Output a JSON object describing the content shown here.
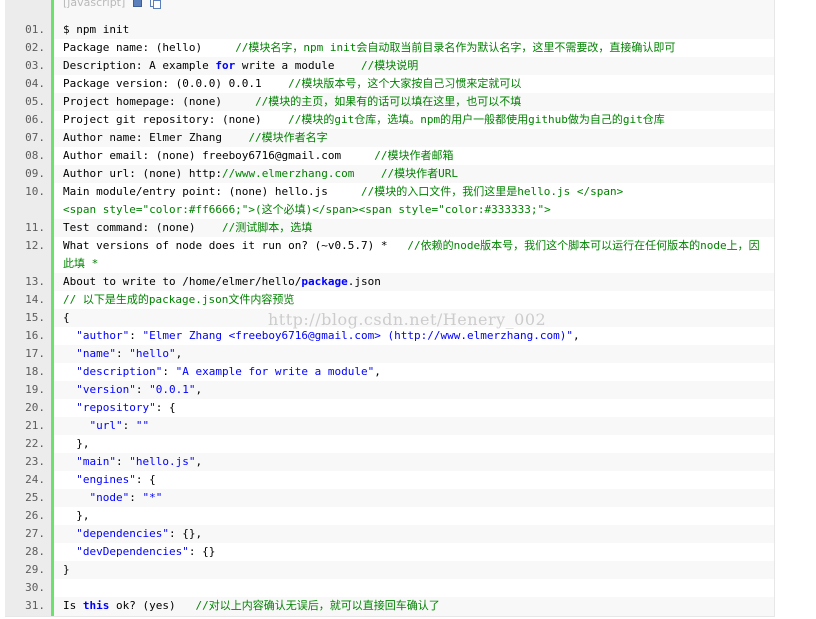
{
  "toolbar": {
    "language_label": "[javascript]",
    "view_icon": "view-source-icon",
    "copy_icon": "copy-icon"
  },
  "watermark": "http://blog.csdn.net/Henery_002",
  "colors": {
    "comment": "#008200",
    "keyword": "#0000ff",
    "gutter_bar": "#6ce26c",
    "line_number": "#5c5c5c"
  },
  "code_lines": [
    {
      "num": "01.",
      "code": "$ npm init",
      "comment": ""
    },
    {
      "num": "02.",
      "code": "Package name: (hello)     ",
      "comment": "//模块名字，npm init会自动取当前目录名作为默认名字，这里不需要改，直接确认即可"
    },
    {
      "num": "03.",
      "pre": "Description: A example ",
      "kw": "for",
      "post": " write a module    ",
      "comment": "//模块说明"
    },
    {
      "num": "04.",
      "code": "Package version: (0.0.0) 0.0.1    ",
      "comment": "//模块版本号，这个大家按自己习惯来定就可以"
    },
    {
      "num": "05.",
      "code": "Project homepage: (none)     ",
      "comment": "//模块的主页，如果有的话可以填在这里，也可以不填"
    },
    {
      "num": "06.",
      "code": "Project git repository: (none)    ",
      "comment": "//模块的git仓库，选填。npm的用户一般都使用github做为自己的git仓库"
    },
    {
      "num": "07.",
      "code": "Author name: Elmer Zhang    ",
      "comment": "//模块作者名字"
    },
    {
      "num": "08.",
      "code": "Author email: (none) freeboy6716@gmail.com     ",
      "comment": "//模块作者邮箱"
    },
    {
      "num": "09.",
      "code": "Author url: (none) http:",
      "comment": "//www.elmerzhang.com    //模块作者URL"
    },
    {
      "num": "10.",
      "code": "Main module/entry point: (none) hello.js     ",
      "comment": "//模块的入口文件，我们这里是hello.js </span>\n<span style=\"color:#ff6666;\">(这个必填)</span><span style=\"color:#333333;\">"
    },
    {
      "num": "11.",
      "code": "Test command: (none)    ",
      "comment": "//测试脚本，选填"
    },
    {
      "num": "12.",
      "code": "What versions of node does it run on? (~v0.5.7) *   ",
      "comment": "//依赖的node版本号，我们这个脚本可以运行在任何版本的node上，因此填 *"
    },
    {
      "num": "13.",
      "pre": "About to write to /home/elmer/hello/",
      "kw": "package",
      "post": ".json",
      "comment": ""
    },
    {
      "num": "14.",
      "code": "",
      "comment": "// 以下是生成的package.json文件内容预览"
    },
    {
      "num": "15.",
      "code": "{",
      "comment": ""
    },
    {
      "num": "16.",
      "pre": "  ",
      "str": "\"author\"",
      "mid": ": ",
      "str2": "\"Elmer Zhang <freeboy6716@gmail.com> (http://www.elmerzhang.com)\"",
      "post": ","
    },
    {
      "num": "17.",
      "pre": "  ",
      "str": "\"name\"",
      "mid": ": ",
      "str2": "\"hello\"",
      "post": ","
    },
    {
      "num": "18.",
      "pre": "  ",
      "str": "\"description\"",
      "mid": ": ",
      "str2": "\"A example for write a module\"",
      "post": ","
    },
    {
      "num": "19.",
      "pre": "  ",
      "str": "\"version\"",
      "mid": ": ",
      "str2": "\"0.0.1\"",
      "post": ","
    },
    {
      "num": "20.",
      "pre": "  ",
      "str": "\"repository\"",
      "mid": ": {",
      "str2": "",
      "post": ""
    },
    {
      "num": "21.",
      "pre": "    ",
      "str": "\"url\"",
      "mid": ": ",
      "str2": "\"\"",
      "post": ""
    },
    {
      "num": "22.",
      "code": "  },",
      "comment": ""
    },
    {
      "num": "23.",
      "pre": "  ",
      "str": "\"main\"",
      "mid": ": ",
      "str2": "\"hello.js\"",
      "post": ","
    },
    {
      "num": "24.",
      "pre": "  ",
      "str": "\"engines\"",
      "mid": ": {",
      "str2": "",
      "post": ""
    },
    {
      "num": "25.",
      "pre": "    ",
      "str": "\"node\"",
      "mid": ": ",
      "str2": "\"*\"",
      "post": ""
    },
    {
      "num": "26.",
      "code": "  },",
      "comment": ""
    },
    {
      "num": "27.",
      "pre": "  ",
      "str": "\"dependencies\"",
      "mid": ": {},",
      "str2": "",
      "post": ""
    },
    {
      "num": "28.",
      "pre": "  ",
      "str": "\"devDependencies\"",
      "mid": ": {}",
      "str2": "",
      "post": ""
    },
    {
      "num": "29.",
      "code": "}",
      "comment": ""
    },
    {
      "num": "30.",
      "code": "",
      "comment": ""
    },
    {
      "num": "31.",
      "pre": "Is ",
      "kw": "this",
      "post": " ok? (yes)   ",
      "comment": "//对以上内容确认无误后，就可以直接回车确认了"
    }
  ]
}
